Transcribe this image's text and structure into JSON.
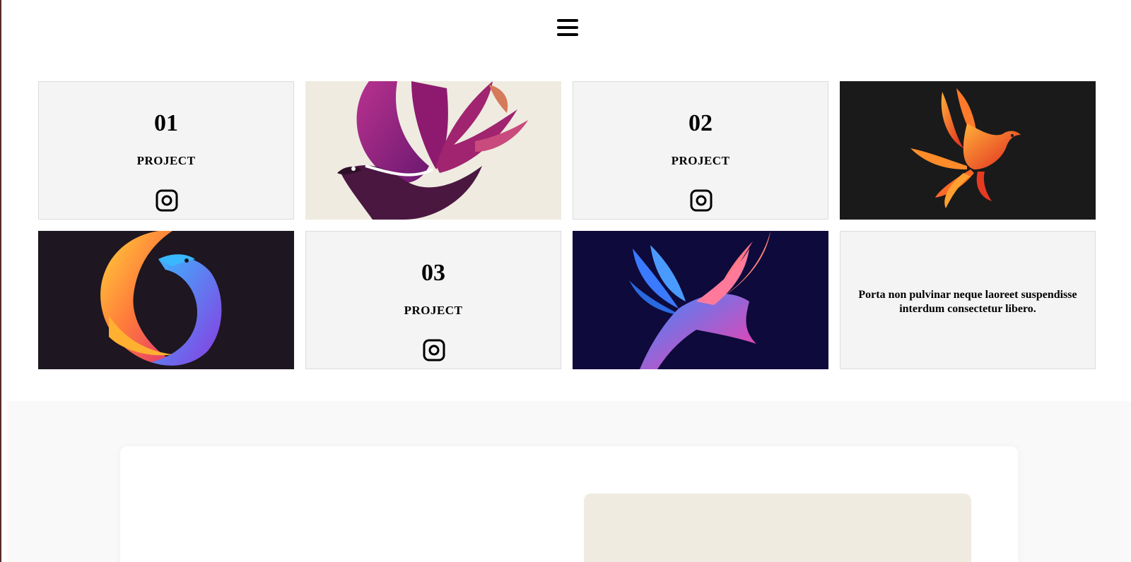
{
  "header": {
    "menu_icon": "hamburger-menu-icon"
  },
  "tiles": [
    {
      "kind": "project",
      "number": "01",
      "label": "PROJECT",
      "icon": "instagram-icon"
    },
    {
      "kind": "image",
      "image": "purple-bird-logo"
    },
    {
      "kind": "project",
      "number": "02",
      "label": "PROJECT",
      "icon": "instagram-icon"
    },
    {
      "kind": "image",
      "image": "phoenix-logo"
    },
    {
      "kind": "image",
      "image": "rainbow-bird-logo"
    },
    {
      "kind": "project",
      "number": "03",
      "label": "PROJECT",
      "icon": "instagram-icon"
    },
    {
      "kind": "image",
      "image": "blue-pink-bird-logo"
    },
    {
      "kind": "text",
      "text": "Porta non pulvinar neque laoreet suspendisse interdum consectetur libero."
    }
  ],
  "colors": {
    "card_bg": "#f4f4f4",
    "section_bg": "#f9f9f9",
    "panel_img_bg": "#efebe1",
    "dark_tile_bg": "#1a1a1a",
    "navy_tile_bg": "#0e0a3b"
  }
}
